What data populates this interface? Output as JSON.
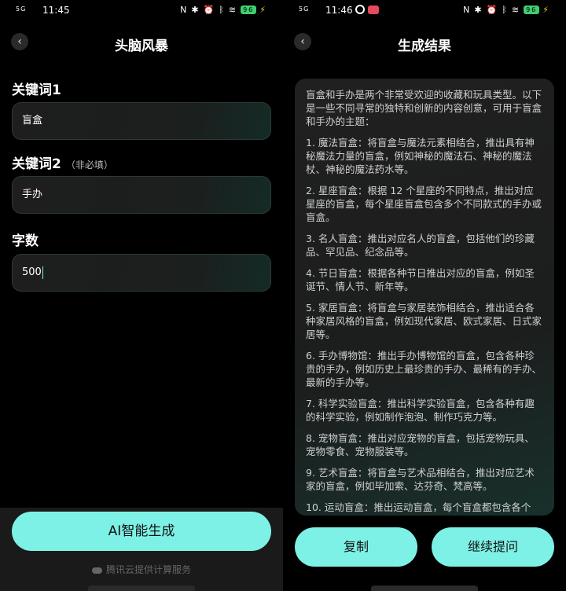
{
  "left": {
    "status": {
      "time": "11:45",
      "signal": "5G",
      "battery": "96"
    },
    "title": "头脑风暴",
    "fields": [
      {
        "label": "关键词1",
        "hint": "",
        "value": "盲盒"
      },
      {
        "label": "关键词2",
        "hint": "（非必填）",
        "value": "手办"
      },
      {
        "label": "字数",
        "hint": "",
        "value": "500"
      }
    ],
    "generate_label": "AI智能生成",
    "footnote": "腾讯云提供计算服务"
  },
  "right": {
    "status": {
      "time": "11:46",
      "signal": "5G",
      "battery": "96"
    },
    "title": "生成结果",
    "paragraphs": [
      "盲盒和手办是两个非常受欢迎的收藏和玩具类型。以下是一些不同寻常的独特和创新的内容创意，可用于盲盒和手办的主题：",
      "1. 魔法盲盒：将盲盒与魔法元素相结合，推出具有神秘魔法力量的盲盒，例如神秘的魔法石、神秘的魔法杖、神秘的魔法药水等。",
      "2. 星座盲盒：根据 12 个星座的不同特点，推出对应星座的盲盒，每个星座盲盒包含多个不同款式的手办或盲盒。",
      "3. 名人盲盒：推出对应名人的盲盒，包括他们的珍藏品、罕见品、纪念品等。",
      "4. 节日盲盒：根据各种节日推出对应的盲盒，例如圣诞节、情人节、新年等。",
      "5. 家居盲盒：将盲盒与家居装饰相结合，推出适合各种家居风格的盲盒，例如现代家居、欧式家居、日式家居等。",
      "6. 手办博物馆：推出手办博物馆的盲盒，包含各种珍贵的手办，例如历史上最珍贵的手办、最稀有的手办、最新的手办等。",
      "7. 科学实验盲盒：推出科学实验盲盒，包含各种有趣的科学实验，例如制作泡泡、制作巧克力等。",
      "8. 宠物盲盒：推出对应宠物的盲盒，包括宠物玩具、宠物零食、宠物服装等。",
      "9. 艺术盲盒：将盲盒与艺术品相结合，推出对应艺术家的盲盒，例如毕加索、达芬奇、梵高等。",
      "10. 运动盲盒：推出运动盲盒，每个盲盒都包含各个"
    ],
    "copy_label": "复制",
    "continue_label": "继续提问"
  }
}
